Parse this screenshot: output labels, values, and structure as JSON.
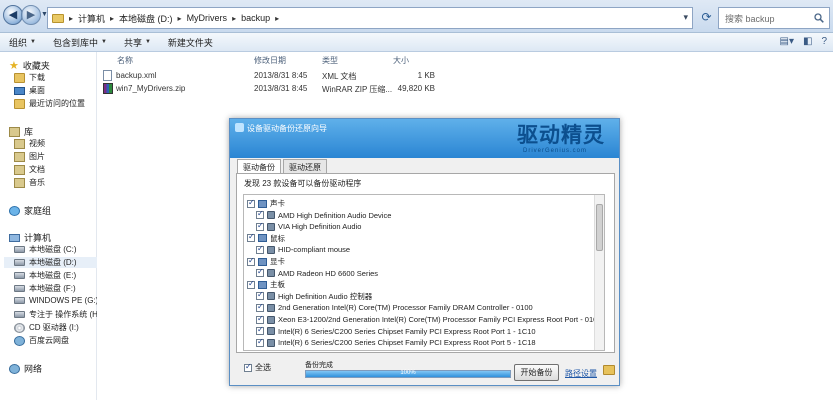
{
  "address": {
    "path": [
      "计算机",
      "本地磁盘 (D:)",
      "MyDrivers",
      "backup"
    ],
    "search_placeholder": "搜索 backup"
  },
  "toolbar": {
    "items": [
      "组织",
      "包含到库中",
      "共享",
      "新建文件夹"
    ]
  },
  "nav": {
    "favorites": "收藏夹",
    "fav_items": [
      "下载",
      "桌面",
      "最近访问的位置"
    ],
    "libraries": "库",
    "lib_items": [
      "视频",
      "图片",
      "文档",
      "音乐"
    ],
    "homegroup": "家庭组",
    "computer": "计算机",
    "drives": [
      "本地磁盘 (C:)",
      "本地磁盘 (D:)",
      "本地磁盘 (E:)",
      "本地磁盘 (F:)",
      "WINDOWS PE (G:)",
      "专注于 操作系统 (H:)",
      "CD 驱动器 (I:)",
      "百度云网盘"
    ],
    "network": "网络"
  },
  "filelist": {
    "headers": {
      "name": "名称",
      "date": "修改日期",
      "type": "类型",
      "size": "大小"
    },
    "files": [
      {
        "name": "backup.xml",
        "date": "2013/8/31 8:45",
        "type": "XML 文档",
        "size": "1 KB"
      },
      {
        "name": "win7_MyDrivers.zip",
        "date": "2013/8/31 8:45",
        "type": "WinRAR ZIP 压缩...",
        "size": "49,820 KB"
      }
    ]
  },
  "dialog": {
    "title": "设备驱动备份还原向导",
    "logo": "驱动精灵",
    "logo_sub": "DriverGenius.com",
    "tabs": [
      "驱动备份",
      "驱动还原"
    ],
    "found": "发现 23 款设备可以备份驱动程序",
    "tree": [
      {
        "kind": "cat",
        "text": "声卡"
      },
      {
        "kind": "dev",
        "text": "AMD High Definition Audio Device"
      },
      {
        "kind": "dev",
        "text": "VIA High Definition Audio"
      },
      {
        "kind": "cat",
        "text": "鼠标"
      },
      {
        "kind": "dev",
        "text": "HID-compliant mouse"
      },
      {
        "kind": "cat",
        "text": "显卡"
      },
      {
        "kind": "dev",
        "text": "AMD Radeon HD 6600 Series"
      },
      {
        "kind": "cat",
        "text": "主板"
      },
      {
        "kind": "dev",
        "text": "High Definition Audio 控制器"
      },
      {
        "kind": "dev",
        "text": "2nd Generation Intel(R) Core(TM) Processor Family DRAM Controller - 0100"
      },
      {
        "kind": "dev",
        "text": "Xeon E3-1200/2nd Generation Intel(R) Core(TM) Processor Family PCI Express Root Port - 010"
      },
      {
        "kind": "dev",
        "text": "Intel(R) 6 Series/C200 Series Chipset Family PCI Express Root Port 1 - 1C10"
      },
      {
        "kind": "dev",
        "text": "Intel(R) 6 Series/C200 Series Chipset Family PCI Express Root Port 5 - 1C18"
      }
    ],
    "select_all": "全选",
    "status": "备份完成",
    "progress_pct": 100,
    "progress_text": "100%",
    "start_button": "开始备份",
    "path_link": "路径设置"
  }
}
